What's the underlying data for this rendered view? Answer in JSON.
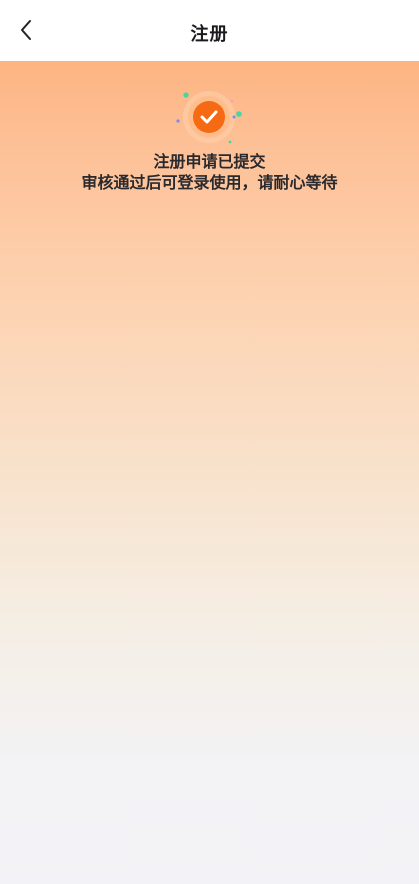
{
  "header": {
    "title": "注册"
  },
  "status": {
    "title": "注册申请已提交",
    "message": "审核通过后可登录使用，请耐心等待"
  },
  "icons": {
    "back": "chevron-left-icon",
    "success": "check-circle-icon"
  },
  "colors": {
    "accent": "#f56a12",
    "gradient_top": "#fdb482",
    "gradient_bottom": "#f3f3f7"
  }
}
